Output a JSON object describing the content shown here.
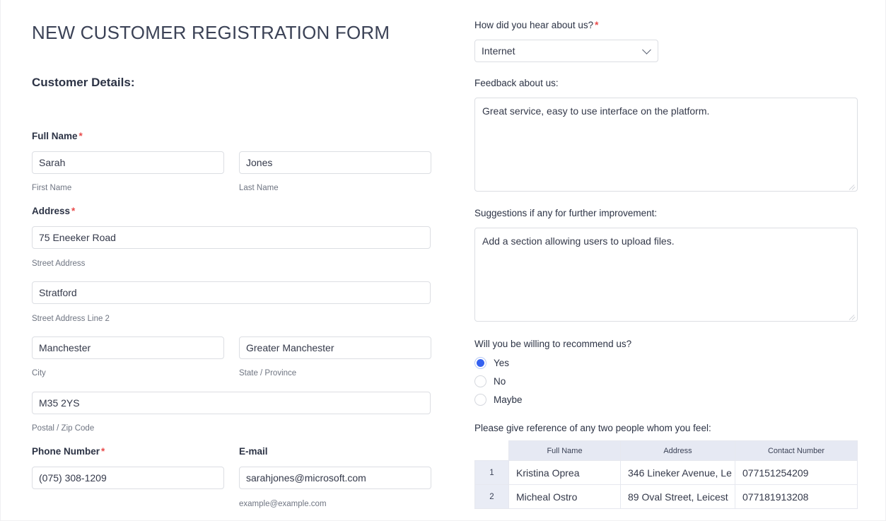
{
  "form": {
    "title": "NEW CUSTOMER REGISTRATION FORM",
    "section_heading": "Customer Details:"
  },
  "left": {
    "full_name": {
      "label": "Full Name",
      "required_mark": "*",
      "first_value": "Sarah",
      "first_sublabel": "First Name",
      "last_value": "Jones",
      "last_sublabel": "Last Name"
    },
    "address": {
      "label": "Address",
      "required_mark": "*",
      "street_value": "75 Eneeker Road",
      "street_sublabel": "Street Address",
      "street2_value": "Stratford",
      "street2_sublabel": "Street Address Line 2",
      "city_value": "Manchester",
      "city_sublabel": "City",
      "state_value": "Greater Manchester",
      "state_sublabel": "State / Province",
      "zip_value": "M35 2YS",
      "zip_sublabel": "Postal / Zip Code"
    },
    "phone": {
      "label": "Phone Number",
      "required_mark": "*",
      "value": "(075) 308-1209"
    },
    "email": {
      "label": "E-mail",
      "value": "sarahjones@microsoft.com",
      "sublabel": "example@example.com"
    }
  },
  "right": {
    "hear_about": {
      "label": "How did you hear about us?",
      "required_mark": "*",
      "selected": "Internet",
      "icon": "chevron-down-icon"
    },
    "feedback": {
      "label": "Feedback about us:",
      "value": "Great service, easy to use interface on the platform."
    },
    "suggestions": {
      "label": "Suggestions if any for further improvement:",
      "value": "Add a section allowing users to upload files."
    },
    "recommend": {
      "label": "Will you be willing to recommend us?",
      "options": [
        {
          "label": "Yes",
          "checked": true
        },
        {
          "label": "No",
          "checked": false
        },
        {
          "label": "Maybe",
          "checked": false
        }
      ]
    },
    "references": {
      "label": "Please give reference of any two people whom you feel:",
      "columns": [
        "Full Name",
        "Address",
        "Contact Number"
      ],
      "rows": [
        {
          "num": "1",
          "name": "Kristina Oprea",
          "address": "346 Lineker Avenue, Le",
          "phone": "077151254209"
        },
        {
          "num": "2",
          "name": "Micheal Ostro",
          "address": "89 Oval Street, Leicest",
          "phone": "077181913208"
        }
      ]
    }
  },
  "colors": {
    "required_red": "#e94b4b",
    "radio_blue": "#3461f0",
    "table_header_bg": "#e6e9f3",
    "text_dark": "#2c3345"
  }
}
